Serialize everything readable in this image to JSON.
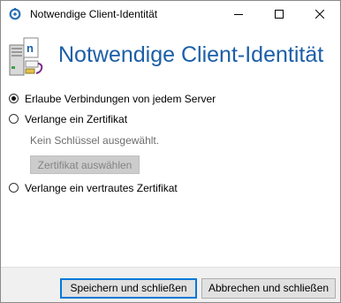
{
  "window": {
    "title": "Notwendige Client-Identität",
    "app_icon": "app-logo-icon",
    "controls": {
      "minimize": "minimize-icon",
      "maximize": "maximize-icon",
      "close": "close-icon"
    }
  },
  "header": {
    "title": "Notwendige Client-Identität",
    "icon": "server-certificate-icon",
    "title_color": "#1c5fa8"
  },
  "options": [
    {
      "label": "Erlaube Verbindungen von jedem Server",
      "selected": true
    },
    {
      "label": "Verlange ein Zertifikat",
      "selected": false
    },
    {
      "label": "Verlange ein vertrautes Zertifikat",
      "selected": false
    }
  ],
  "certificate": {
    "status_text": "Kein Schlüssel ausgewählt.",
    "choose_button": "Zertifikat auswählen"
  },
  "footer": {
    "save_button": "Speichern und schließen",
    "cancel_button": "Abbrechen und schließen",
    "accent_color": "#0078d7"
  }
}
